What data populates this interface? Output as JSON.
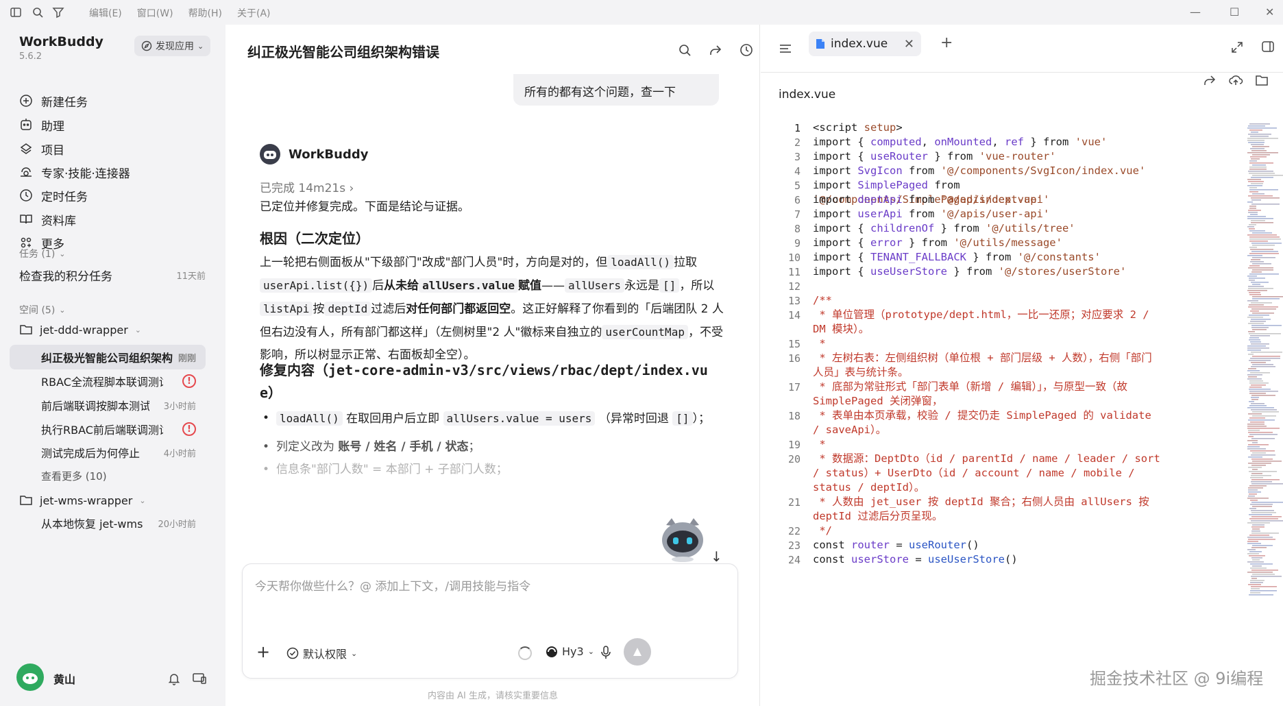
{
  "titlebar": {
    "menus": [
      "编辑(E)",
      "窗口(W)",
      "帮助(H)",
      "关于(A)"
    ]
  },
  "sidebar": {
    "brand": "WorkBuddy",
    "version": "5.6.2",
    "discover_label": "发现应用",
    "nav": [
      {
        "label": "新建任务",
        "icon": "plus-circle-icon"
      },
      {
        "label": "助理",
        "icon": "assistant-icon"
      },
      {
        "label": "项目",
        "icon": "project-icon"
      },
      {
        "label": "专家·技能·连接器",
        "icon": "expert-icon"
      },
      {
        "label": "定时任务",
        "icon": "clock-icon"
      },
      {
        "label": "资料库",
        "icon": "book-icon"
      },
      {
        "label": "更多",
        "icon": "grid-icon"
      }
    ],
    "tasks_header": "任务 (1)",
    "tasks": [
      {
        "label": "检查我的积分任务",
        "time": "11天前"
      }
    ],
    "spaces_header": "空间 (5)",
    "ws1": {
      "name": "jet-ddd-wrapper",
      "items": [
        {
          "label": "纠正极光智能公司组织架构",
          "time": "刚刚"
        },
        {
          "label": "RBAC全流程脚本联调测试",
          "time": ""
        },
        {
          "label": "前后端联调按脚本测试",
          "time": "3小时前"
        },
        {
          "label": "执行RBAC前后端联调测试",
          "time": ""
        },
        {
          "label": "测试完成后为何停止",
          "time": "4小时前"
        }
      ],
      "more": "查看更多 (10)"
    },
    "ws2": {
      "name": "jet-wms-wrapper",
      "items": [
        {
          "label": "从本地恢复 jet-wms",
          "time": "20小时前"
        }
      ]
    },
    "user": {
      "name": "黄山"
    }
  },
  "chat": {
    "title": "纠正极光智能公司组织架构错误",
    "user_message": "所有的都有这个问题，查一下",
    "bot_name": "WorkBuddy",
    "status": "已完成 14m21s",
    "intro": "已定位并修复完成。下面是结论与证据。",
    "root_cause_title": "根因（二次定位）",
    "root_cause": {
      "t1": "上一轮把右侧面板从\"下级部门\"改成\"部门人员\"时，方向是对的，但",
      "c1": "loadAll()",
      "t2": "拉取",
      "c2": "userApi.list({})",
      "t3": "后",
      "b1": "从未给",
      "c3": "allUsers.value",
      "b2": "赋值",
      "t4": "——",
      "c4": "allUsers",
      "t5": "永远是",
      "c5": "[]",
      "t6": "，所以",
      "c6": "listApi",
      "t7": "按",
      "c7": "deptId",
      "t8": "过滤后",
      "b3": "对任何部门都返回空",
      "t9": "。这正好解释了你看到的「后端团队 2 人但右边没有人，所有部门都这样」（左侧树里\"2 人\"徽标来自独立的",
      "c8": "userCountMap",
      "t10": "，不受影响，所以树显示正常、右面板却全空）。"
    },
    "fix_title_prefix": "修复内容（",
    "fix_path": "jet-core-admin-v3/src/views/rbac/dept/index.vue",
    "fix_title_suffix": "）",
    "fix_items": [
      {
        "c1": "loadAll()",
        "t1": "在取回用户后立即",
        "c2": "allUsers.value = users",
        "t2": "（异常时回退",
        "c3": "[]",
        "t3": "）；"
      },
      {
        "t1": "列定义改为",
        "b1": "账号 / 姓名 / 手机 / 状态",
        "t2": "；"
      },
      {
        "t1": "信息条\"部门人数\" = 本部门 + 子部门人数；"
      }
    ],
    "input_placeholder": "今天帮你做些什么？@ 添加上下文，/调用技能与指令",
    "permission_label": "默认权限",
    "model_label": "Hy3",
    "disclaimer": "内容由 AI 生成，请核实重要信息"
  },
  "editor": {
    "tab_label": "index.vue",
    "file_label": "index.vue",
    "lines": [
      {
        "n": "1",
        "html": "&lt;script <span class='attr'>setup</span>&gt;"
      },
      {
        "n": "2",
        "html": "import { <span class='id'>computed</span>, <span class='id'>onMounted</span>, <span class='id'>ref</span> } from <span class='str'>'vue'</span>"
      },
      {
        "n": "3",
        "html": "import { <span class='id'>useRouter</span> } from <span class='str'>'vue-router'</span>"
      },
      {
        "n": "4",
        "html": "import <span class='id'>SvgIcon</span> from <span class='str'>'@/components/SvgIcon/index.vue'</span>"
      },
      {
        "n": "5",
        "html": "import <span class='id'>SimplePaged</span> from <span class='str'>'@/components/SimplePaged/index.vue'</span>"
      },
      {
        "n": "6",
        "html": "import <span class='id'>deptApi</span> from <span class='str'>'@/apis/dept-api'</span>"
      },
      {
        "n": "7",
        "html": "import <span class='id'>userApi</span> from <span class='str'>'@/apis/user-api'</span>"
      },
      {
        "n": "8",
        "html": "import { <span class='id'>childrenOf</span> } from <span class='str'>'@/utils/tree'</span>"
      },
      {
        "n": "9",
        "html": "import { <span class='id'>error</span> } from <span class='str'>'@/utils/message'</span>"
      },
      {
        "n": "10",
        "html": "import { <span class='id'>TENANT_FALLBACK</span> } from <span class='str'>'@/constants'</span>"
      },
      {
        "n": "11",
        "html": "import { <span class='id'>useUserStore</span> } from <span class='str'>'@/stores/userStore'</span>"
      },
      {
        "n": "12",
        "html": ""
      },
      {
        "n": "13",
        "html": "<span class='cm'>/**</span>"
      },
      {
        "n": "14",
        "html": "<span class='cm'> * 单位管理（prototype/dept.html，一比一还原；对应要求 2 / DM 模块）。</span>"
      },
      {
        "n": "15",
        "html": "<span class='cm'> *</span>"
      },
      {
        "n": "16",
        "html": "<span class='cm'> * 左树右表：左侧组织树（单位根 + 部门层级 + 人数），右侧「部门人员」表与统计条。</span>"
      },
      {
        "n": "17",
        "html": "<span class='cm'> * 底部为常驻形式「部门表单（新增 / 编辑）」，与原型一致（故 SimplePaged 关闭弹窗，</span>"
      },
      {
        "n": "18",
        "html": "<span class='cm'> * 表单由本页承载，校验 / 提交仍走 SimplePaged 的 validate / saveApi）。</span>"
      },
      {
        "n": "19",
        "html": "<span class='cm'> *</span>"
      },
      {
        "n": "20",
        "html": "<span class='cm'> * 数据源：DeptDto（id / parentId / name / leader / sort / status）+ UserDto（id / account / name / mobile / status / deptId）。</span>"
      },
      {
        "n": "21",
        "html": "<span class='cm'> * 人数由 jet_user 按 deptId 聚合；右侧人员由 allUsers 按 deptId 过滤后分页呈现。</span>"
      },
      {
        "n": "22",
        "html": "<span class='cm'> */</span>"
      },
      {
        "n": "23",
        "html": "const <span class='id'>router</span> = <span class='fn'>useRouter</span>()"
      },
      {
        "n": "24",
        "html": "const <span class='id'>userStore</span> = <span class='fn'>useUserStore</span>()"
      }
    ]
  },
  "watermark": "掘金技术社区 @ 9i编程"
}
